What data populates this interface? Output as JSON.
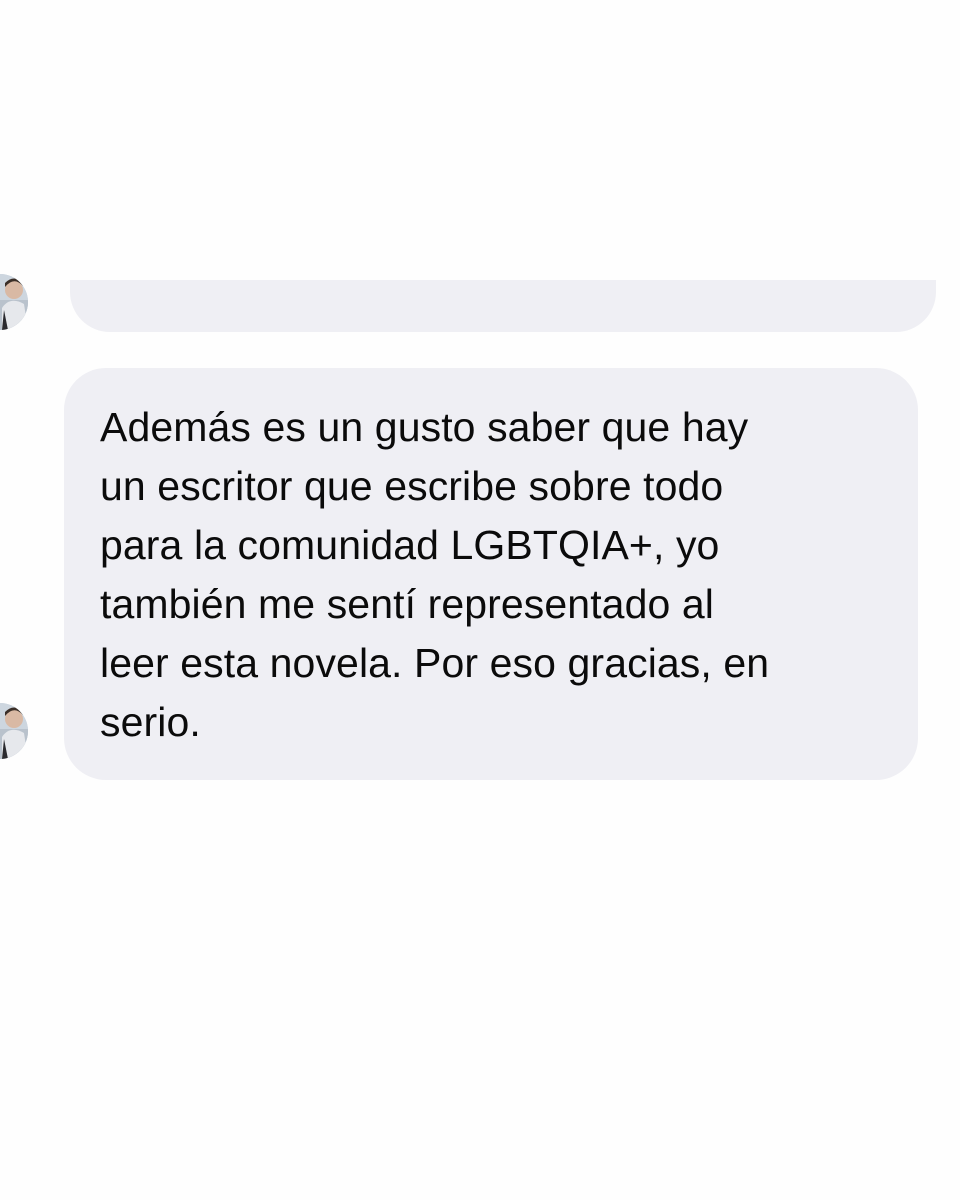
{
  "conversation": {
    "messages": [
      {
        "sender": "other",
        "text": "",
        "avatar_icon": "profile-photo-icon"
      },
      {
        "sender": "other",
        "text": "Además es un gusto saber que hay\nun escritor que escribe sobre todo\npara la comunidad LGBTQIA+, yo\ntambién me sentí representado al\nleer esta novela. Por eso gracias, en\nserio.",
        "avatar_icon": "profile-photo-icon"
      }
    ]
  },
  "colors": {
    "background": "#fefefe",
    "bubble": "#efeff4",
    "text": "#0b0b0b"
  }
}
